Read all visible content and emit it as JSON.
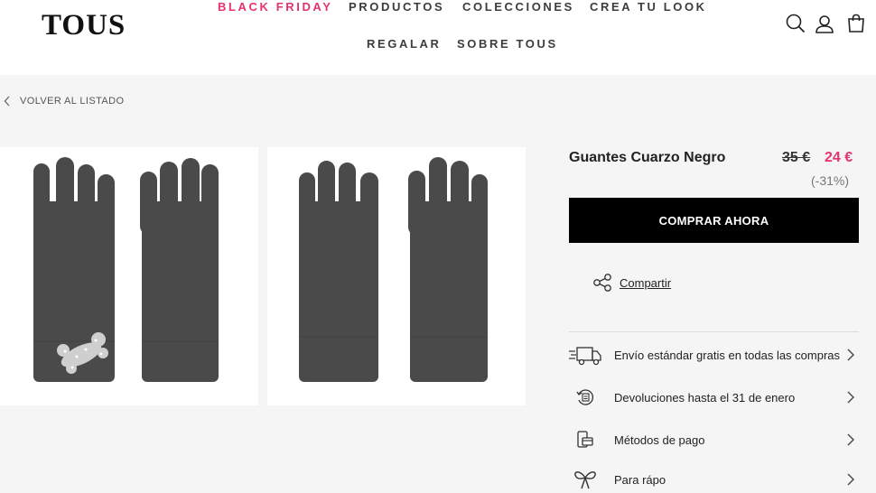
{
  "brand": {
    "logo": "TOUS"
  },
  "nav": {
    "items": [
      {
        "label": "BLACK FRIDAY",
        "highlight": true
      },
      {
        "label": "PRODUCTOS"
      },
      {
        "label": "COLECCIONES"
      },
      {
        "label": "CREA TU LOOK"
      },
      {
        "label": "REGALAR"
      },
      {
        "label": "SOBRE TOUS"
      }
    ]
  },
  "header_icons": [
    "search-icon",
    "user-icon",
    "shopping-bag-icon"
  ],
  "back_link": "VOLVER AL LISTADO",
  "product": {
    "name": "Guantes Cuarzo Negro",
    "old_price": "35 €",
    "price": "24 €",
    "discount": "(-31%)",
    "buy_label": "COMPRAR AHORA",
    "share_label": "Compartir"
  },
  "info_rows": [
    {
      "icon": "delivery-truck-icon",
      "label": "Envío estándar gratis en todas las compras"
    },
    {
      "icon": "returns-icon",
      "label": "Devoluciones hasta el 31 de enero"
    },
    {
      "icon": "payment-methods-icon",
      "label": "Métodos de pago"
    },
    {
      "icon": "gift-bow-icon",
      "label": "Para rápo"
    }
  ],
  "colors": {
    "accent": "#e5336d",
    "button": "#000000",
    "background": "#f5f5f5"
  }
}
